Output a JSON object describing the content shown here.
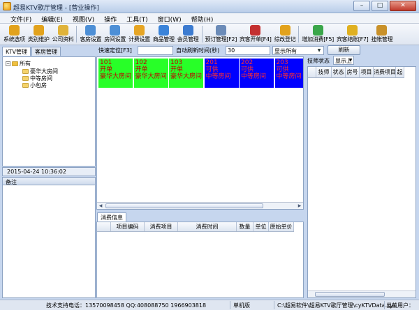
{
  "window": {
    "title": "超易KTV歌厅管理 - [营业操作]"
  },
  "menu": [
    "文件(F)",
    "编辑(E)",
    "视图(V)",
    "操作",
    "工具(T)",
    "窗口(W)",
    "帮助(H)"
  ],
  "toolbar": [
    {
      "label": "系统选项",
      "icon": "settings-icon",
      "color": "#e2a21c"
    },
    {
      "label": "类别维护",
      "icon": "category-icon",
      "color": "#e2a21c"
    },
    {
      "label": "公司资料",
      "icon": "company-icon",
      "color": "#e0b33a"
    },
    {
      "label": "客房设置",
      "icon": "room-settings-icon",
      "color": "#4d8fd6"
    },
    {
      "label": "房间设置",
      "icon": "room-icon",
      "color": "#4d8fd6"
    },
    {
      "label": "计费设置",
      "icon": "billing-icon",
      "color": "#e6a525"
    },
    {
      "label": "商品管理",
      "icon": "goods-icon",
      "color": "#3a83d9"
    },
    {
      "label": "会员管理",
      "icon": "member-icon",
      "color": "#3c7bd0"
    },
    {
      "label": "预订管理[F2]",
      "icon": "reservation-icon",
      "color": "#6b8bb8"
    },
    {
      "label": "宾客开单[F4]",
      "icon": "open-order-icon",
      "color": "#c43030"
    },
    {
      "label": "综改登记",
      "icon": "register-icon",
      "color": "#e2a21c"
    },
    {
      "label": "增加消费[F5]",
      "icon": "add-consumption-icon",
      "color": "#3aa64a"
    },
    {
      "label": "宾客结账[F7]",
      "icon": "checkout-icon",
      "color": "#e0b020"
    },
    {
      "label": "挂帐管理",
      "icon": "credit-icon",
      "color": "#c9912a"
    }
  ],
  "left_tabs": [
    "KTV管理",
    "客房管理"
  ],
  "quick": {
    "locate_label": "快速定位[F3]",
    "locate_value": "",
    "refresh_time_label": "自动刷新时间(秒)",
    "refresh_time_value": "30",
    "filter_value": "显示所有",
    "refresh_button": "刷新"
  },
  "tree": {
    "root": "所有",
    "items": [
      "豪华大房间",
      "中等房间",
      "小包房"
    ]
  },
  "datetime": "2015-04-24 10:36:02",
  "remark_label": "备注",
  "rooms": [
    {
      "number": "101",
      "status": "开单",
      "type": "豪华大房间",
      "color": "green"
    },
    {
      "number": "102",
      "status": "开单",
      "type": "豪华大房间",
      "color": "green"
    },
    {
      "number": "103",
      "status": "开单",
      "type": "豪华大房间",
      "color": "green"
    },
    {
      "number": "201",
      "status": "可供",
      "type": "中等房间",
      "color": "blue"
    },
    {
      "number": "202",
      "status": "可供",
      "type": "中等房间",
      "color": "blue"
    },
    {
      "number": "203",
      "status": "可供",
      "type": "中等房间",
      "color": "blue"
    }
  ],
  "consume": {
    "tab_label": "消费信息",
    "columns": [
      "项目编码",
      "消费项目",
      "消费时间",
      "数量",
      "单位",
      "原始单价"
    ]
  },
  "tech": {
    "status_label": "技师状态",
    "status_value": "显示上",
    "columns": [
      "技师",
      "状态",
      "房号",
      "项目",
      "消费项目",
      "起"
    ]
  },
  "statusbar": {
    "support": "技术支持电话：13570098458 QQ:408088750 1966903818",
    "edition": "单机版",
    "path": "C:\\超易软件\\超易KTV歌厅管理\\cyKTVData.sys",
    "user": "当前用户："
  }
}
